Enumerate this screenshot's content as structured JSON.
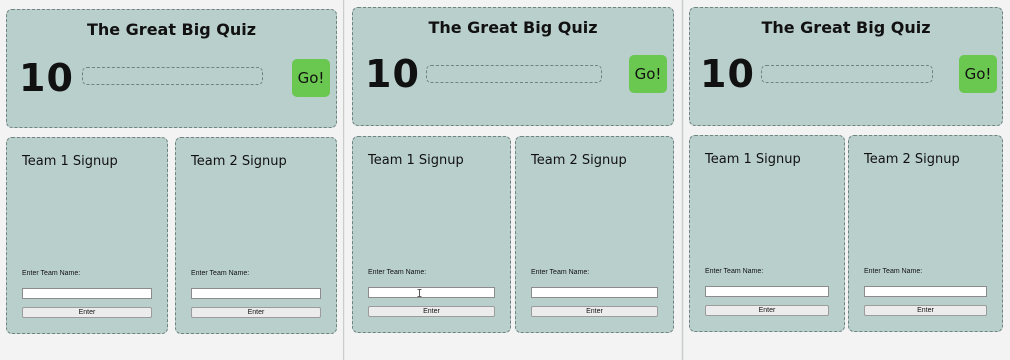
{
  "quiz": {
    "title": "The Great Big Quiz",
    "timer": "10",
    "go_label": "Go!",
    "answer_value": ""
  },
  "teams": [
    {
      "title": "Team 1 Signup",
      "label": "Enter Team Name:",
      "value": "",
      "button": "Enter"
    },
    {
      "title": "Team 2 Signup",
      "label": "Enter Team Name:",
      "value": "",
      "button": "Enter"
    }
  ],
  "colors": {
    "panel": "#b9cfcc",
    "go_button": "#6ac74f",
    "page": "#f2f3f2"
  },
  "icons": {
    "cursor": "text-cursor-icon"
  }
}
